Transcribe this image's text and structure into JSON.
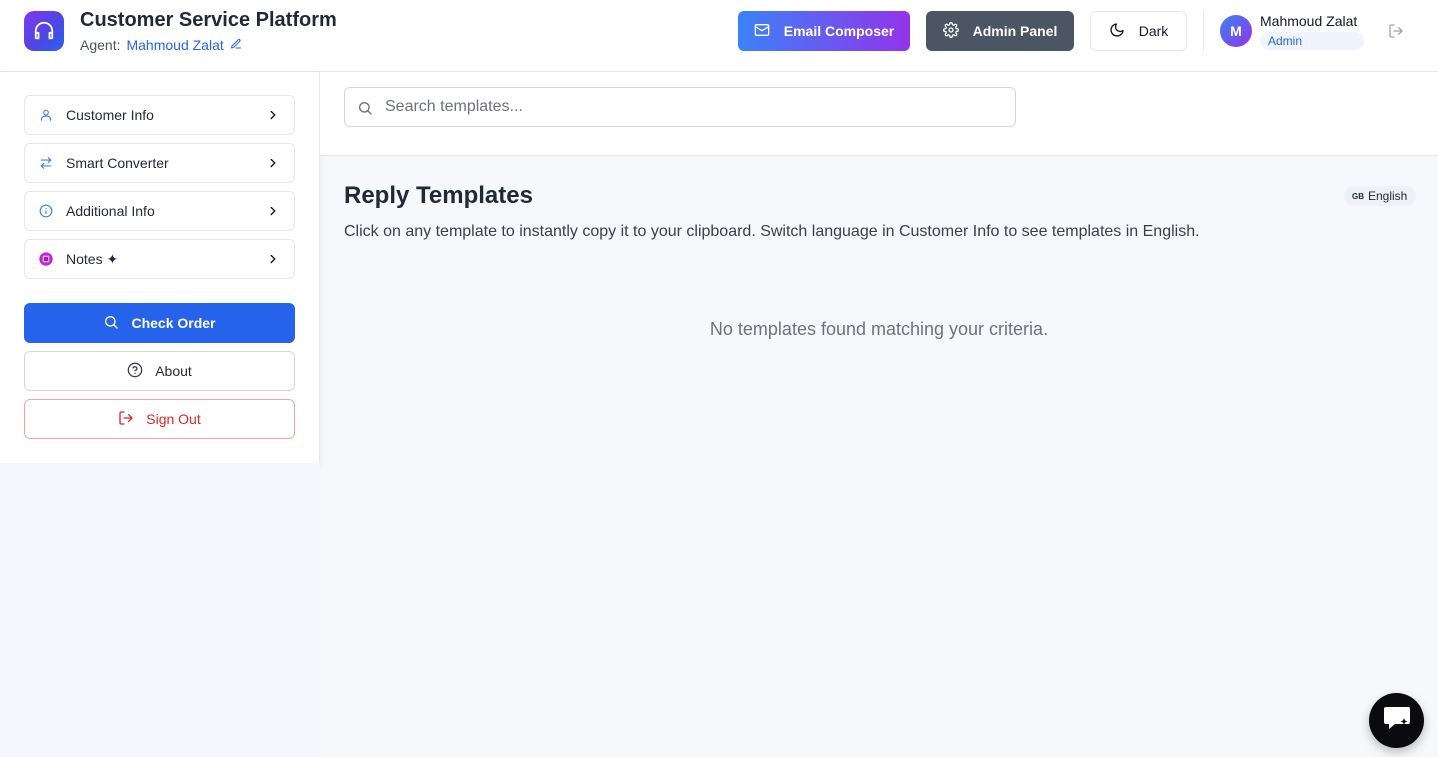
{
  "header": {
    "title": "Customer Service Platform",
    "agent_label": "Agent:",
    "agent_name": "Mahmoud Zalat",
    "email_composer": "Email Composer",
    "admin_panel": "Admin Panel",
    "theme_toggle": "Dark",
    "user": {
      "initial": "M",
      "name": "Mahmoud Zalat",
      "role": "Admin"
    }
  },
  "sidebar": {
    "items": [
      {
        "label": "Customer Info",
        "icon": "user-icon"
      },
      {
        "label": "Smart Converter",
        "icon": "swap-arrows-icon"
      },
      {
        "label": "Additional Info",
        "icon": "info-icon"
      },
      {
        "label": "Notes ✦",
        "icon": "notes-icon"
      }
    ],
    "check_order": "Check Order",
    "about": "About",
    "sign_out": "Sign Out"
  },
  "search": {
    "placeholder": "Search templates..."
  },
  "main": {
    "title": "Reply Templates",
    "language_flag": "GB",
    "language": "English",
    "description": "Click on any template to instantly copy it to your clipboard. Switch language in Customer Info to see templates in English.",
    "empty_message": "No templates found matching your criteria."
  },
  "colors": {
    "primary": "#2563eb",
    "danger": "#dc2626",
    "admin_button": "#4b5563",
    "accent_gradient_start": "#3b82f6",
    "accent_gradient_end": "#9333ea"
  }
}
